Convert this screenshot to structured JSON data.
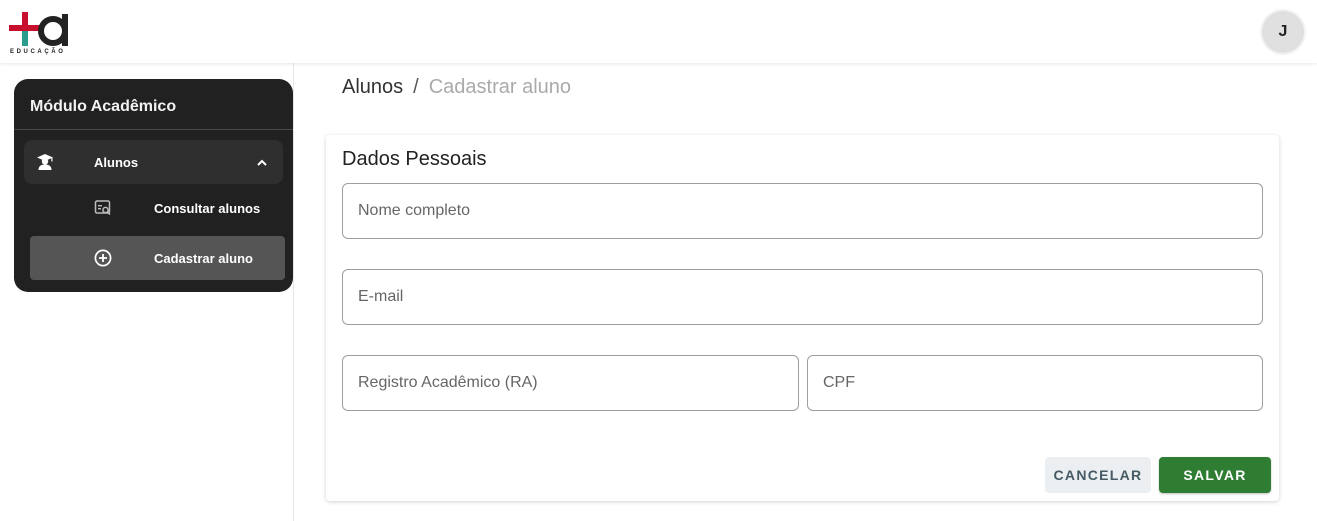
{
  "header": {
    "logo_text": "EDUCAÇÃO",
    "avatar_initial": "J",
    "brand_colors": {
      "red": "#c8102e",
      "teal": "#2a9d8f",
      "dark": "#222222"
    }
  },
  "sidebar": {
    "title": "Módulo Acadêmico",
    "group": {
      "label": "Alunos",
      "icon": "student-icon",
      "expanded": true
    },
    "items": [
      {
        "label": "Consultar alunos",
        "icon": "search-list-icon",
        "active": false
      },
      {
        "label": "Cadastrar aluno",
        "icon": "add-circle-icon",
        "active": true
      }
    ]
  },
  "breadcrumb": {
    "parent": "Alunos",
    "separator": "/",
    "current": "Cadastrar aluno"
  },
  "form": {
    "section_title": "Dados Pessoais",
    "fields": {
      "nome": {
        "placeholder": "Nome completo",
        "value": ""
      },
      "email": {
        "placeholder": "E-mail",
        "value": ""
      },
      "ra": {
        "placeholder": "Registro Acadêmico (RA)",
        "value": ""
      },
      "cpf": {
        "placeholder": "CPF",
        "value": ""
      }
    },
    "cancel_label": "CANCELAR",
    "save_label": "SALVAR"
  },
  "colors": {
    "sidebar_bg": "#212121",
    "active_item_bg": "#555555",
    "save_button": "#2e7d32",
    "cancel_button_bg": "#eceff1",
    "cancel_button_text": "#455a64"
  }
}
